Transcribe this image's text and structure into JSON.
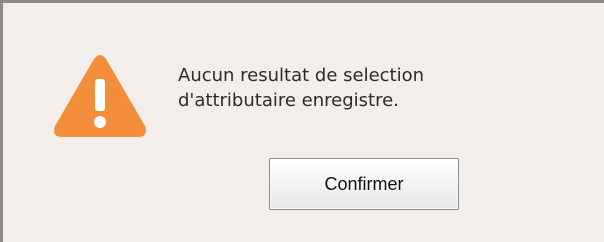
{
  "dialog": {
    "icon": "warning-icon",
    "message_lines": [
      "Aucun resultat de selection",
      "d'attributaire enregistre."
    ],
    "confirm_label": "Confirmer"
  },
  "colors": {
    "background": "#f3eee9",
    "warning": "#f28e3a",
    "border": "#8a8a8a"
  }
}
